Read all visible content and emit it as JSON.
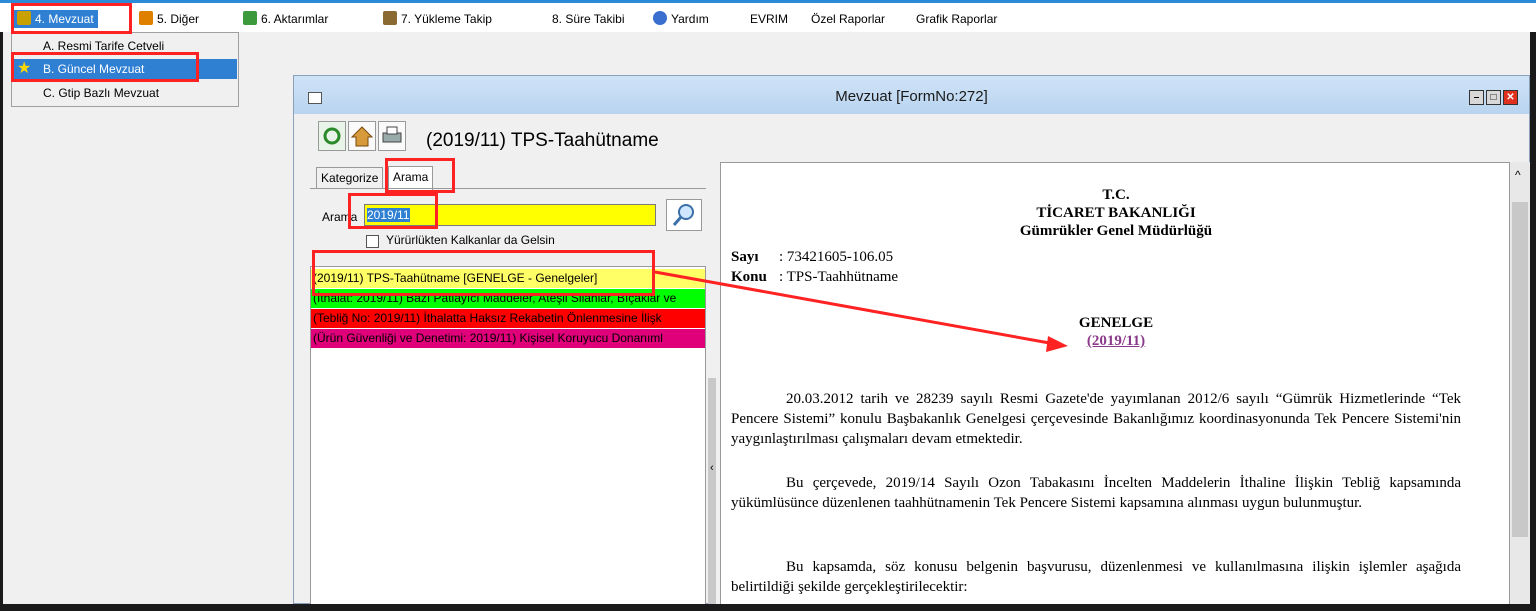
{
  "menu": {
    "items": [
      {
        "label": "4. Mevzuat",
        "icon": "books-icon"
      },
      {
        "label": "5. Diğer",
        "icon": "gear-people-icon"
      },
      {
        "label": "6. Aktarımlar",
        "icon": "transfer-icon"
      },
      {
        "label": "7. Yükleme Takip",
        "icon": "upload-icon"
      },
      {
        "label": "8. Süre Takibi",
        "icon": ""
      },
      {
        "label": "Yardım",
        "icon": "help-icon"
      },
      {
        "label": "EVRIM",
        "icon": ""
      },
      {
        "label": "Özel Raporlar",
        "icon": ""
      },
      {
        "label": "Grafik Raporlar",
        "icon": ""
      }
    ]
  },
  "dropdown": {
    "items": [
      {
        "label": "A. Resmi Tarife Cetveli"
      },
      {
        "label": "B. Güncel Mevzuat"
      },
      {
        "label": "C. Gtip Bazlı Mevzuat"
      }
    ]
  },
  "window": {
    "title": "Mevzuat [FormNo:272]",
    "doc_title": "(2019/11) TPS-Taahütname"
  },
  "left": {
    "tabs": [
      "Kategorize",
      "Arama"
    ],
    "search_label": "Arama",
    "search_value": "2019/11",
    "checkbox_label": "Yürürlükten Kalkanlar da Gelsin",
    "results": [
      {
        "text": "(2019/11) TPS-Taahütname [GENELGE - Genelgeler]",
        "bg": "#ffff66"
      },
      {
        "text": "(İthalat: 2019/11) Bazı Patlayıcı Maddeler, Ateşli Silahlar, Bıçaklar ve",
        "bg": "#00ff00"
      },
      {
        "text": "(Tebliğ No: 2019/11) İthalatta Haksız Rekabetin Önlenmesine İlişk",
        "bg": "#ff0000"
      },
      {
        "text": "(Ürün Güvenliği ve Denetimi: 2019/11) Kişisel Koruyucu Donanıml",
        "bg": "#e0007a"
      }
    ]
  },
  "doc": {
    "header1": "T.C.",
    "header2": "TİCARET BAKANLIĞI",
    "header3": "Gümrükler Genel Müdürlüğü",
    "sayi_label": "Sayı",
    "sayi_value": ": 73421605-106.05",
    "konu_label": "Konu",
    "konu_value": ": TPS-Taahhütname",
    "genelge": "GENELGE",
    "genelge_no": "(2019/11)",
    "para1": "20.03.2012 tarih ve 28239 sayılı Resmi Gazete'de yayımlanan 2012/6 sayılı “Gümrük Hizmetlerinde “Tek Pencere Sistemi” konulu Başbakanlık Genelgesi çerçevesinde Bakanlığımız koordinasyonunda Tek Pencere Sistemi'nin yaygınlaştırılması çalışmaları devam etmektedir.",
    "para2": "Bu çerçevede, 2019/14 Sayılı Ozon Tabakasını İncelten Maddelerin İthaline İlişkin Tebliğ kapsamında yükümlüsünce düzenlenen taahhütnamenin Tek Pencere Sistemi kapsamına alınması uygun bulunmuştur.",
    "para3": "Bu kapsamda, söz konusu belgenin başvurusu, düzenlenmesi ve kullanılmasına ilişkin işlemler aşağıda belirtildiği şekilde gerçekleştirilecektir:"
  },
  "colors": {
    "accent": "#2f7fd3",
    "highlight_box": "#ff2222",
    "search_bg": "#ffff00"
  }
}
